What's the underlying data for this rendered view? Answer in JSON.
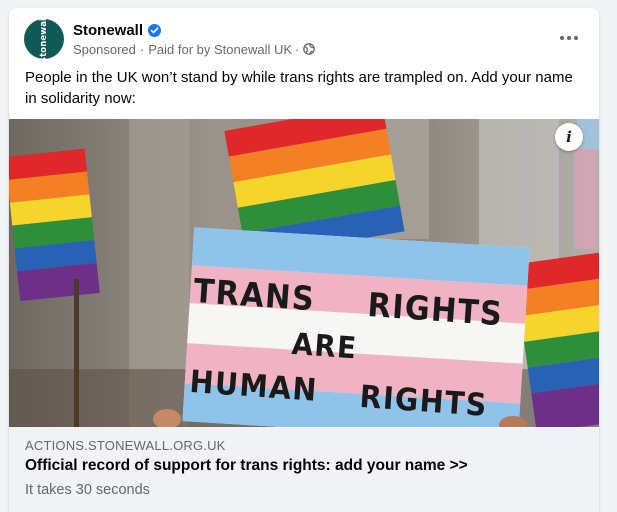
{
  "post": {
    "page_name": "Stonewall",
    "avatar_text": "Stonewall",
    "sponsored_label": "Sponsored",
    "separator": "·",
    "paid_for": "Paid for by Stonewall UK",
    "audience_icon": "globe-icon",
    "more_icon": "more-options-icon",
    "verified_icon": "verified-badge-icon",
    "text": "People in the UK won’t stand by while trans rights are trampled on. Add your name in solidarity now:"
  },
  "media": {
    "info_icon": "info-icon",
    "info_glyph": "i",
    "sign_line1_left": "TRANS",
    "sign_line1_right": "RIGHTS",
    "sign_line2": "ARE",
    "sign_line3_left": "HUMAN",
    "sign_line3_right": "RIGHTS"
  },
  "link": {
    "domain": "ACTIONS.STONEWALL.ORG.UK",
    "headline": "Official record of support for trans rights: add your name >>",
    "subline": "It takes 30 seconds"
  },
  "colors": {
    "brand_avatar": "#0f5a57",
    "verified_blue": "#1877f2",
    "trans_blue": "#8fc3ea",
    "trans_pink": "#efb3c3"
  }
}
